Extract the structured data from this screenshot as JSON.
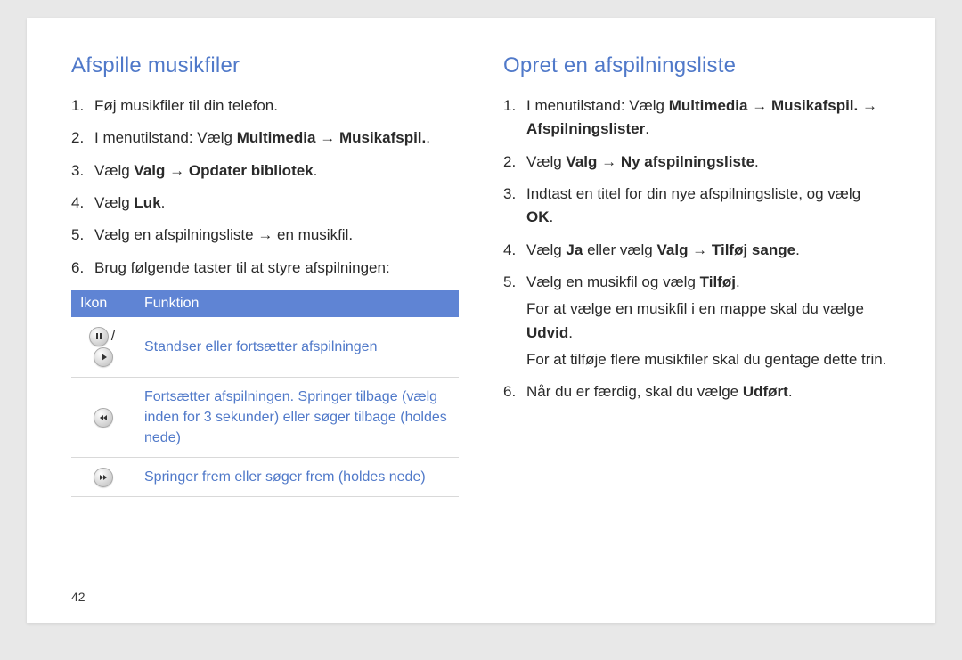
{
  "left": {
    "heading": "Afspille musikfiler",
    "steps": [
      {
        "parts": [
          {
            "t": "Føj musikfiler til din telefon."
          }
        ]
      },
      {
        "parts": [
          {
            "t": "I menutilstand: Vælg "
          },
          {
            "t": "Multimedia",
            "b": true
          },
          {
            "t": " → "
          },
          {
            "t": "Musikafspil.",
            "b": true
          },
          {
            "t": "."
          }
        ]
      },
      {
        "parts": [
          {
            "t": "Vælg "
          },
          {
            "t": "Valg",
            "b": true
          },
          {
            "t": " → "
          },
          {
            "t": "Opdater bibliotek",
            "b": true
          },
          {
            "t": "."
          }
        ]
      },
      {
        "parts": [
          {
            "t": "Vælg "
          },
          {
            "t": "Luk",
            "b": true
          },
          {
            "t": "."
          }
        ]
      },
      {
        "parts": [
          {
            "t": "Vælg en afspilningsliste → en musikfil."
          }
        ]
      },
      {
        "parts": [
          {
            "t": "Brug følgende taster til at styre afspilningen:"
          }
        ]
      }
    ],
    "table": {
      "head_icon": "Ikon",
      "head_func": "Funktion",
      "rows": [
        {
          "icon": "pauseplay",
          "func": "Standser eller fortsætter afspilningen"
        },
        {
          "icon": "prev",
          "func": "Fortsætter afspilningen. Springer tilbage (vælg inden for 3 sekunder) eller søger tilbage (holdes nede)"
        },
        {
          "icon": "next",
          "func": "Springer frem eller søger frem (holdes nede)"
        }
      ]
    }
  },
  "right": {
    "heading": "Opret en afspilningsliste",
    "steps": [
      {
        "parts": [
          {
            "t": "I menutilstand: Vælg "
          },
          {
            "t": "Multimedia",
            "b": true
          },
          {
            "t": " → "
          },
          {
            "t": "Musikafspil.",
            "b": true
          },
          {
            "t": " → "
          },
          {
            "t": "Afspilningslister",
            "b": true
          },
          {
            "t": "."
          }
        ]
      },
      {
        "parts": [
          {
            "t": "Vælg "
          },
          {
            "t": "Valg",
            "b": true
          },
          {
            "t": " → "
          },
          {
            "t": "Ny afspilningsliste",
            "b": true
          },
          {
            "t": "."
          }
        ]
      },
      {
        "parts": [
          {
            "t": "Indtast en titel for din nye afspilningsliste, og vælg "
          },
          {
            "t": "OK",
            "b": true
          },
          {
            "t": "."
          }
        ]
      },
      {
        "parts": [
          {
            "t": "Vælg "
          },
          {
            "t": "Ja",
            "b": true
          },
          {
            "t": " eller vælg "
          },
          {
            "t": "Valg",
            "b": true
          },
          {
            "t": " → "
          },
          {
            "t": "Tilføj sange",
            "b": true
          },
          {
            "t": "."
          }
        ]
      },
      {
        "parts": [
          {
            "t": "Vælg en musikfil og vælg "
          },
          {
            "t": "Tilføj",
            "b": true
          },
          {
            "t": "."
          }
        ],
        "sublines": [
          [
            {
              "t": "For at vælge en musikfil i en mappe skal du vælge "
            },
            {
              "t": "Udvid",
              "b": true
            },
            {
              "t": "."
            }
          ],
          [
            {
              "t": "For at tilføje flere musikfiler skal du gentage dette trin."
            }
          ]
        ]
      },
      {
        "parts": [
          {
            "t": "Når du er færdig, skal du vælge "
          },
          {
            "t": "Udført",
            "b": true
          },
          {
            "t": "."
          }
        ]
      }
    ]
  },
  "page_number": "42",
  "icon_names": {
    "pauseplay_sep": "/"
  }
}
